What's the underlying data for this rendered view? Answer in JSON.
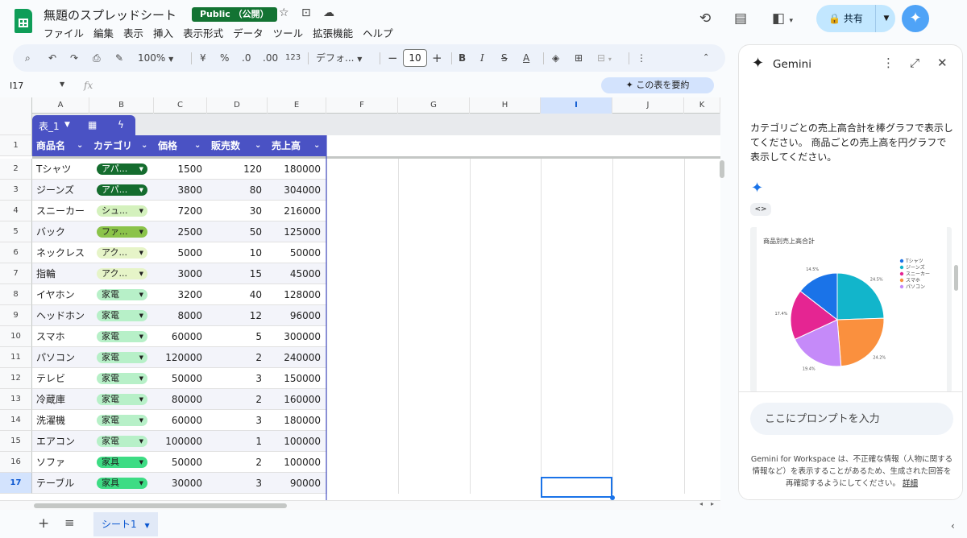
{
  "header": {
    "doc_title": "無題のスプレッドシート",
    "public_badge": "Public （公開）",
    "share_label": "共有"
  },
  "menu": [
    "ファイル",
    "編集",
    "表示",
    "挿入",
    "表示形式",
    "データ",
    "ツール",
    "拡張機能",
    "ヘルプ"
  ],
  "toolbar": {
    "zoom": "100%",
    "currency": "¥",
    "percent": "%",
    "dec_decrease": ".0",
    "dec_increase": ".00",
    "number_format": "123",
    "font_name": "デフォ...",
    "font_size": "10"
  },
  "formula_bar": {
    "cell_ref": "I17",
    "fx": "fx",
    "summarize_label": "この表を要約"
  },
  "columns": [
    "A",
    "B",
    "C",
    "D",
    "E",
    "F",
    "G",
    "H",
    "I",
    "J",
    "K"
  ],
  "table": {
    "name": "表_1",
    "headers": [
      "商品名",
      "カテゴリ",
      "価格",
      "販売数",
      "売上高"
    ],
    "rows": [
      {
        "n": "2",
        "name": "Tシャツ",
        "cat": "アパ...",
        "price": "1500",
        "qty": "120",
        "sales": "180000"
      },
      {
        "n": "3",
        "name": "ジーンズ",
        "cat": "アパ...",
        "price": "3800",
        "qty": "80",
        "sales": "304000"
      },
      {
        "n": "4",
        "name": "スニーカー",
        "cat": "シュ...",
        "price": "7200",
        "qty": "30",
        "sales": "216000"
      },
      {
        "n": "5",
        "name": "バック",
        "cat": "ファ...",
        "price": "2500",
        "qty": "50",
        "sales": "125000"
      },
      {
        "n": "6",
        "name": "ネックレス",
        "cat": "アク...",
        "price": "5000",
        "qty": "10",
        "sales": "50000"
      },
      {
        "n": "7",
        "name": "指輪",
        "cat": "アク...",
        "price": "3000",
        "qty": "15",
        "sales": "45000"
      },
      {
        "n": "8",
        "name": "イヤホン",
        "cat": "家電",
        "price": "3200",
        "qty": "40",
        "sales": "128000"
      },
      {
        "n": "9",
        "name": "ヘッドホン",
        "cat": "家電",
        "price": "8000",
        "qty": "12",
        "sales": "96000"
      },
      {
        "n": "10",
        "name": "スマホ",
        "cat": "家電",
        "price": "60000",
        "qty": "5",
        "sales": "300000"
      },
      {
        "n": "11",
        "name": "パソコン",
        "cat": "家電",
        "price": "120000",
        "qty": "2",
        "sales": "240000"
      },
      {
        "n": "12",
        "name": "テレビ",
        "cat": "家電",
        "price": "50000",
        "qty": "3",
        "sales": "150000"
      },
      {
        "n": "13",
        "name": "冷蔵庫",
        "cat": "家電",
        "price": "80000",
        "qty": "2",
        "sales": "160000"
      },
      {
        "n": "14",
        "name": "洗濯機",
        "cat": "家電",
        "price": "60000",
        "qty": "3",
        "sales": "180000"
      },
      {
        "n": "15",
        "name": "エアコン",
        "cat": "家電",
        "price": "100000",
        "qty": "1",
        "sales": "100000"
      },
      {
        "n": "16",
        "name": "ソファ",
        "cat": "家具",
        "price": "50000",
        "qty": "2",
        "sales": "100000"
      },
      {
        "n": "17",
        "name": "テーブル",
        "cat": "家具",
        "price": "30000",
        "qty": "3",
        "sales": "90000"
      }
    ]
  },
  "chip_colors": {
    "アパ...": {
      "bg": "#146c2e",
      "fg": "#ffffff"
    },
    "シュ...": {
      "bg": "#d4f1bd",
      "fg": "#1f1f1f"
    },
    "ファ...": {
      "bg": "#8bc34a",
      "fg": "#1f1f1f"
    },
    "アク...": {
      "bg": "#e6f4c8",
      "fg": "#1f1f1f"
    },
    "家電": {
      "bg": "#b7f0c8",
      "fg": "#1f1f1f"
    },
    "家具": {
      "bg": "#3ddc84",
      "fg": "#1f1f1f"
    }
  },
  "sheet_tab": "シート1",
  "gemini": {
    "title": "Gemini",
    "prompt": "カテゴリごとの売上高合計を棒グラフで表示してください。 商品ごとの売上高を円グラフで表示してください。",
    "code_chip": "<>",
    "input_placeholder": "ここにプロンプトを入力",
    "disclaimer": "Gemini for Workspace は、不正確な情報（人物に関する情報など）を表示することがあるため、生成された回答を再確認するようにしてください。",
    "details_link": "詳細"
  },
  "chart_data": {
    "type": "pie",
    "title": "商品別売上高合計",
    "legend": [
      "Tシャツ",
      "ジーンズ",
      "スニーカー",
      "スマホ",
      "パソコン"
    ],
    "colors": [
      "#1a73e8",
      "#12b5cb",
      "#e52592",
      "#fa903e",
      "#c58af9"
    ],
    "slices": [
      {
        "name": "ジーンズ",
        "value": 24.5,
        "label": "24.5%",
        "color": "#12b5cb"
      },
      {
        "name": "スマホ",
        "value": 24.2,
        "label": "24.2%",
        "color": "#fa903e"
      },
      {
        "name": "パソコン",
        "value": 19.4,
        "label": "19.4%",
        "color": "#c58af9"
      },
      {
        "name": "スニーカー",
        "value": 17.4,
        "label": "17.4%",
        "color": "#e52592"
      },
      {
        "name": "Tシャツ",
        "value": 14.5,
        "label": "14.5%",
        "color": "#1a73e8"
      }
    ],
    "legend_position": "right"
  }
}
